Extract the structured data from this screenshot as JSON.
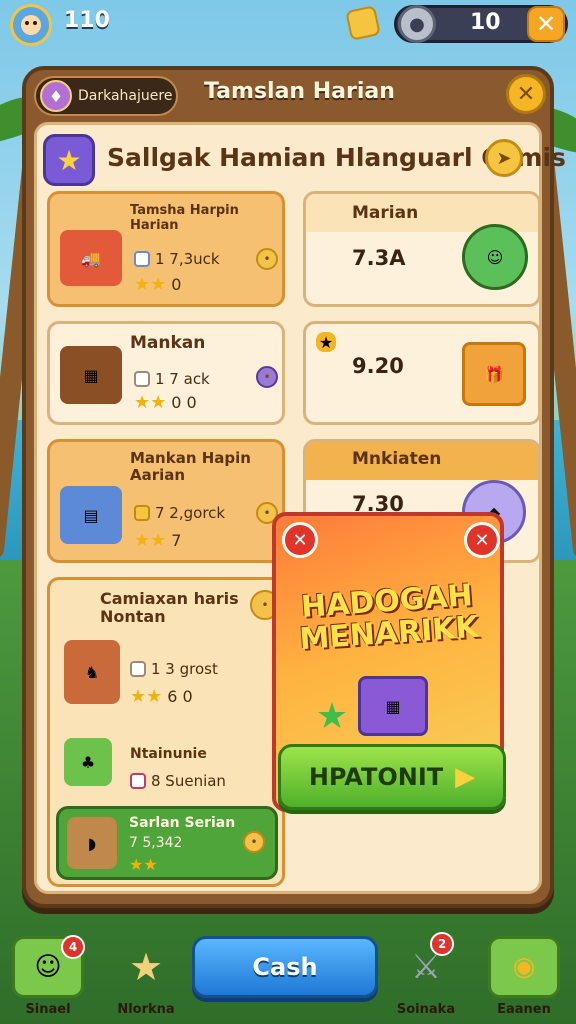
{
  "hud": {
    "level": "110",
    "coins": "10",
    "add_label": "✕"
  },
  "panel": {
    "tag_label": "Darkahajuere",
    "title": "Tamslan Harian",
    "header_text": "Sallgak Hamian Hlanguarl Camis"
  },
  "cards": [
    {
      "title": "Tamsha Harpin\nHarian",
      "line": "1 7,3uck",
      "stars_value": "0"
    },
    {
      "title": "Marian",
      "value": "7.3A"
    },
    {
      "title": "Mankan",
      "line": "1 7 ack",
      "stars_value": "0 0"
    },
    {
      "value": "9.20"
    },
    {
      "title": "Mankan Hapin\nAarian",
      "line": "7 2,gorck",
      "stars_value": "7"
    },
    {
      "title": "Mnkiaten",
      "value": "7.30"
    },
    {
      "title": "Camiaxan haris\nNontan",
      "line": "1 3 grost",
      "stars_value": "6 0"
    }
  ],
  "sub_items": [
    {
      "title": "Ntainunie",
      "line": "8 Suenian"
    },
    {
      "title": "Sarlan Serian",
      "line": "7 5,342"
    }
  ],
  "promo": {
    "title_line1": "HADOGAH",
    "title_line2": "MENARIKK",
    "button_label": "HPATONIT"
  },
  "nav": {
    "items": [
      {
        "label": "Sinael",
        "badge": "4"
      },
      {
        "label": "Nlorkna"
      },
      {
        "label": "Cash"
      },
      {
        "label": "Soinaka",
        "badge": "2"
      },
      {
        "label": "Eaanen"
      }
    ]
  }
}
